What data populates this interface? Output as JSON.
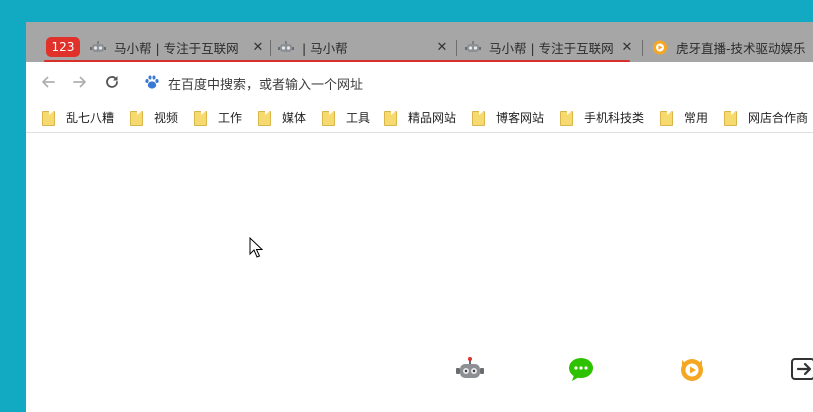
{
  "tabs": {
    "counter": "123",
    "items": [
      {
        "title": "马小帮 | 专注于互联网",
        "favicon": "robot-icon"
      },
      {
        "title": "| 马小帮",
        "favicon": "robot-icon"
      },
      {
        "title": "马小帮 | 专注于互联网",
        "favicon": "robot-icon"
      },
      {
        "title": "虎牙直播-技术驱动娱乐",
        "favicon": "huya-icon"
      }
    ],
    "close_glyph": "✕"
  },
  "omnibox": {
    "placeholder": "在百度中搜索，或者输入一个网址",
    "engine_icon": "baidu-paw-icon"
  },
  "bookmarks": [
    "乱七八糟",
    "视频",
    "工作",
    "媒体",
    "工具",
    "精品网站",
    "博客网站",
    "手机科技类",
    "常用",
    "网店合作商"
  ],
  "dock": [
    "robot-icon",
    "wechat-icon",
    "huya-icon",
    "exit-icon"
  ],
  "colors": {
    "desktop": "#12a9c2",
    "tabstrip": "#a6a6a6",
    "counter": "#e0312a",
    "loading": "#d5302a",
    "folder": "#f6da6f"
  }
}
